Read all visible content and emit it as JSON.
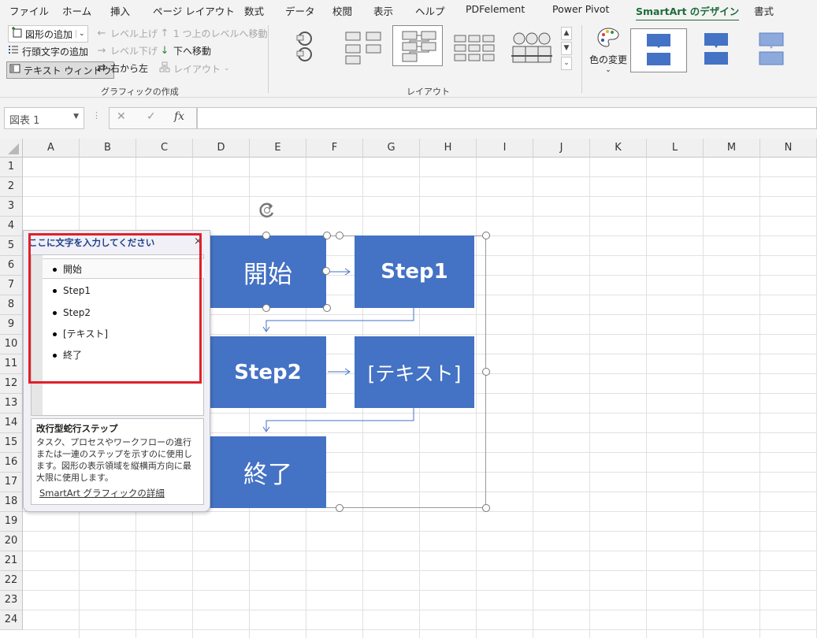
{
  "tabs": [
    "ファイル",
    "ホーム",
    "挿入",
    "ページ レイアウト",
    "数式",
    "データ",
    "校閲",
    "表示",
    "ヘルプ",
    "PDFelement",
    "Power Pivot",
    "SmartArt のデザイン",
    "書式"
  ],
  "active_tab": "SmartArt のデザイン",
  "ribbon": {
    "create_graphic": {
      "add_shape": "図形の追加",
      "add_bullet": "行頭文字の追加",
      "text_pane": "テキスト ウィンドウ",
      "promote": "レベル上げ",
      "demote": "レベル下げ",
      "right_to_left": "右から左",
      "move_up": "1 つ上のレベルへ移動",
      "move_down": "下へ移動",
      "layout_btn": "レイアウト",
      "group_label": "グラフィックの作成"
    },
    "layouts": {
      "group_label": "レイアウト"
    },
    "styles": {
      "change_colors": "色の変更"
    }
  },
  "formula_bar": {
    "name_box": "図表 1",
    "fx": "fx",
    "value": ""
  },
  "grid": {
    "columns": [
      "A",
      "B",
      "C",
      "D",
      "E",
      "F",
      "G",
      "H",
      "I",
      "J",
      "K",
      "L",
      "M",
      "N"
    ],
    "rows": [
      "1",
      "2",
      "3",
      "4",
      "5",
      "6",
      "7",
      "8",
      "9",
      "10",
      "11",
      "12",
      "13",
      "14",
      "15",
      "16",
      "17",
      "18",
      "19",
      "20",
      "21",
      "22",
      "23",
      "24"
    ]
  },
  "smartart": {
    "boxes": [
      "開始",
      "Step1",
      "Step2",
      "[テキスト]",
      "終了"
    ],
    "box_color": "#4472c4"
  },
  "text_pane": {
    "title": "ここに文字を入力してください",
    "close": "×",
    "items": [
      "開始",
      "Step1",
      "Step2",
      "[テキスト]",
      "終了"
    ],
    "desc_title": "改行型蛇行ステップ",
    "desc_body": "タスク、プロセスやワークフローの進行または一連のステップを示すのに使用します。図形の表示領域を縦横両方向に最大限に使用します。",
    "desc_link": "SmartArt グラフィックの詳細"
  },
  "highlight_color": "#e0202a"
}
